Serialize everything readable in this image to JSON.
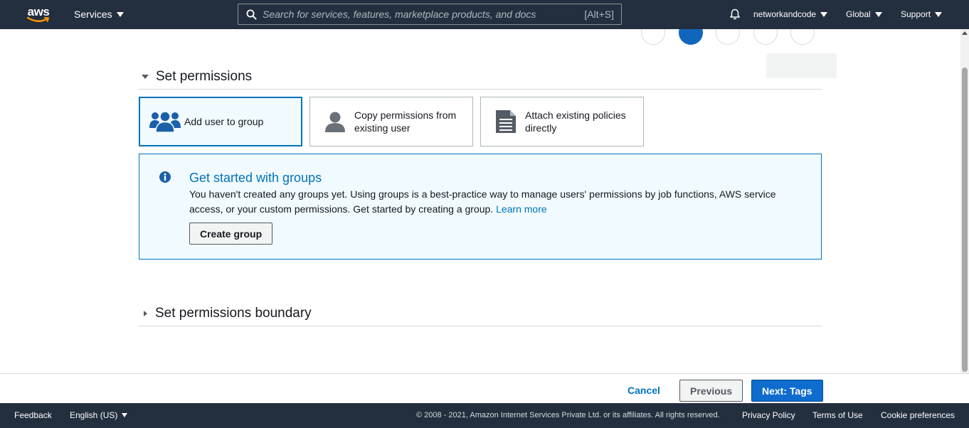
{
  "topnav": {
    "logo_text": "aws",
    "services_label": "Services",
    "search_placeholder": "Search for services, features, marketplace products, and docs",
    "search_shortcut": "[Alt+S]",
    "account_label": "networkandcode",
    "region_label": "Global",
    "support_label": "Support"
  },
  "permissions": {
    "section_title": "Set permissions",
    "options": [
      {
        "label": "Add user to group",
        "icon": "group-icon",
        "selected": true
      },
      {
        "label": "Copy permissions from existing user",
        "icon": "user-icon",
        "selected": false
      },
      {
        "label": "Attach existing policies directly",
        "icon": "document-icon",
        "selected": false
      }
    ]
  },
  "info": {
    "title": "Get started with groups",
    "text": "You haven't created any groups yet. Using groups is a best-practice way to manage users' permissions by job functions, AWS service access, or your custom permissions. Get started by creating a group.",
    "learn_more": "Learn more",
    "create_button": "Create group"
  },
  "boundary": {
    "section_title": "Set permissions boundary"
  },
  "actions": {
    "cancel": "Cancel",
    "previous": "Previous",
    "next": "Next: Tags"
  },
  "footer": {
    "feedback": "Feedback",
    "language": "English (US)",
    "copyright": "© 2008 - 2021, Amazon Internet Services Private Ltd. or its affiliates. All rights reserved.",
    "privacy": "Privacy Policy",
    "terms": "Terms of Use",
    "cookies": "Cookie preferences"
  },
  "colors": {
    "nav_bg": "#232f3e",
    "accent": "#0073bb",
    "primary_button": "#0f6ccf"
  }
}
